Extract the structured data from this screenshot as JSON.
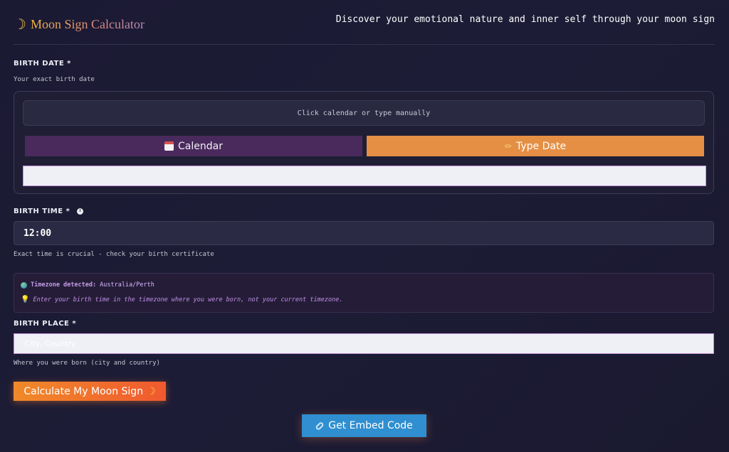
{
  "header": {
    "logo_icon": "crescent-moon-icon",
    "title": "Moon Sign Calculator",
    "tagline": "Discover your emotional nature and inner self through your moon sign"
  },
  "birth_date": {
    "label": "BIRTH DATE *",
    "hint": "Your exact birth date",
    "placeholder": "Click calendar or type manually",
    "calendar_button": "Calendar",
    "type_button": "Type Date",
    "typed_value": ""
  },
  "birth_time": {
    "label": "BIRTH TIME *",
    "value": "12:00",
    "hint": "Exact time is crucial - check your birth certificate"
  },
  "timezone": {
    "detected_label": "Timezone detected:",
    "detected_value": "Australia/Perth",
    "note": "Enter your birth time in the timezone where you were born, not your current timezone."
  },
  "birth_place": {
    "label": "BIRTH PLACE *",
    "placeholder": "City, Country",
    "hint": "Where you were born (city and country)"
  },
  "actions": {
    "calculate": "Calculate My Moon Sign",
    "embed": "Get Embed Code"
  },
  "colors": {
    "background": "#1c1b34",
    "accent_orange": "#e58f45",
    "accent_purple": "#4a2a5c",
    "embed_blue": "#2f8fd0"
  }
}
